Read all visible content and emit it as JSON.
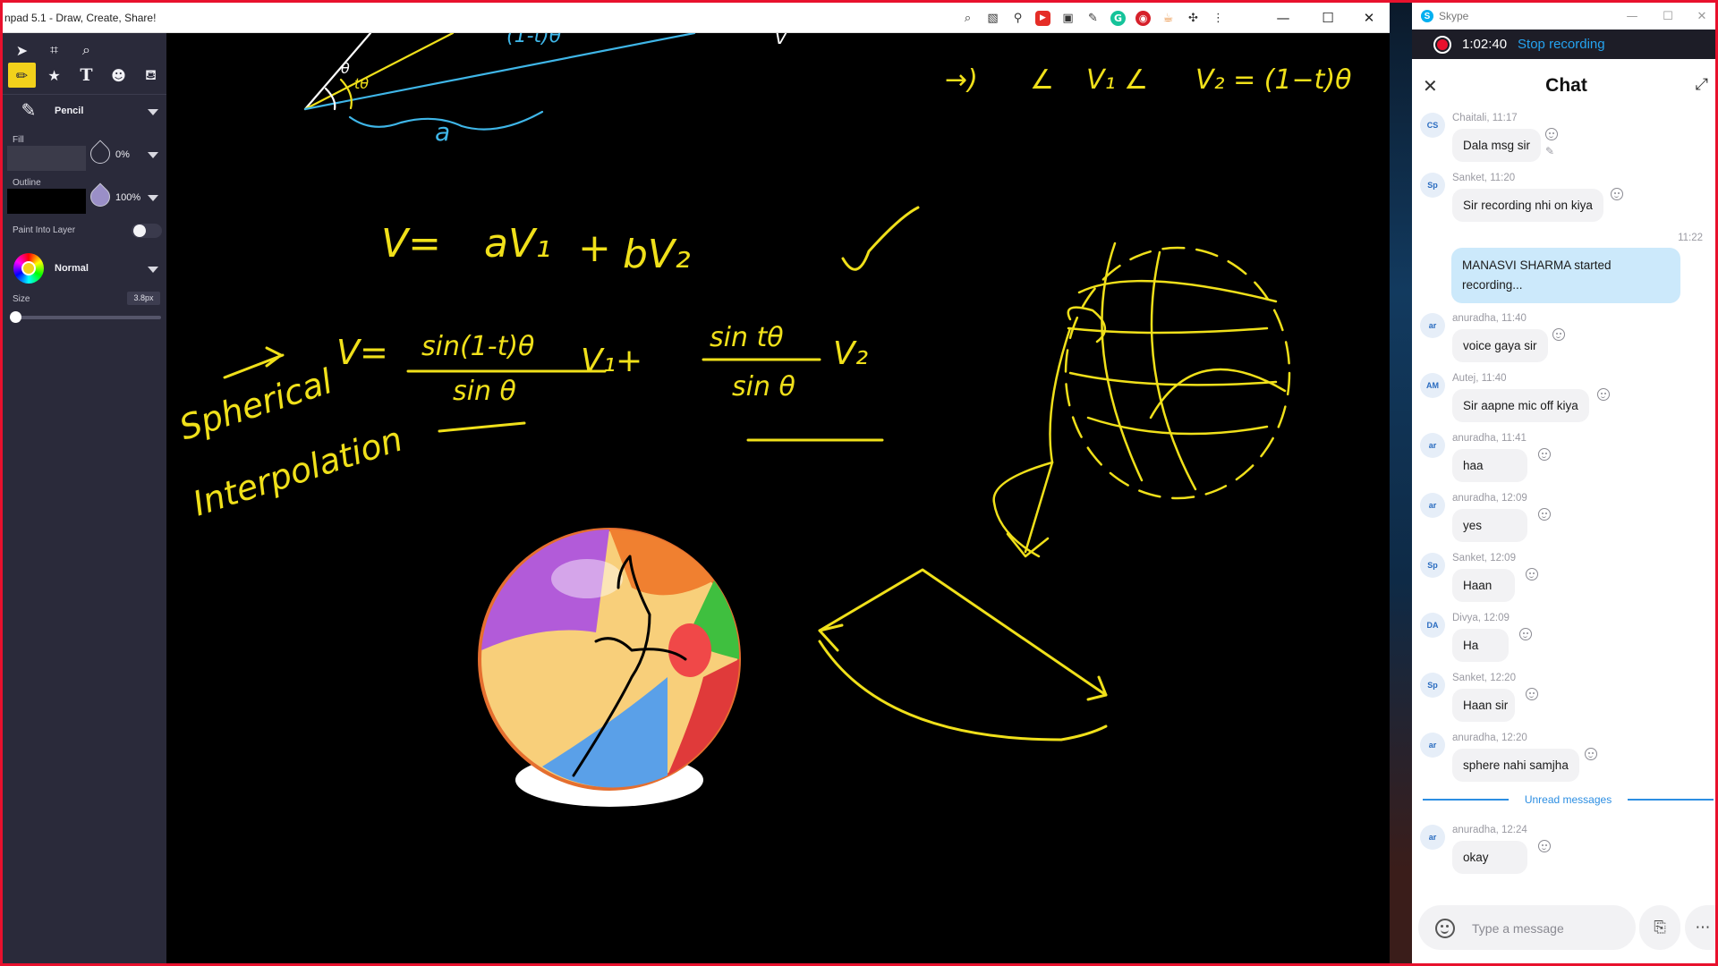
{
  "app": {
    "title": "npad 5.1 - Draw, Create, Share!",
    "window_controls": {
      "minimize": "—",
      "maximize": "☐",
      "close": "✕"
    }
  },
  "toolbar": {
    "tool_icons": [
      "pointer-icon",
      "crop-icon",
      "magnifier-icon",
      "pencil-icon",
      "star-icon",
      "text-icon",
      "sticker-icon",
      "fill-bucket-icon"
    ],
    "tool_label": "Pencil",
    "fill_label": "Fill",
    "fill_opacity": "0%",
    "outline_label": "Outline",
    "outline_opacity": "100%",
    "paint_into_layer_label": "Paint Into Layer",
    "paint_into_layer_on": false,
    "blend_mode": "Normal",
    "size_label": "Size",
    "size_value": "3.8px",
    "active_color": "#f2d11b"
  },
  "canvas": {
    "background": "#000000",
    "ink_color": "#f0e01a",
    "secondary_ink": "#3fb6e8"
  },
  "skype": {
    "window_title": "Skype",
    "window_controls": {
      "minimize": "—",
      "maximize": "☐",
      "close": "✕"
    },
    "recording_time": "1:02:40",
    "stop_recording": "Stop recording",
    "chat_title": "Chat",
    "messages": [
      {
        "avatar": "CS",
        "meta": "Chaitali, 11:17",
        "text": "Dala msg sir"
      },
      {
        "avatar": "Sp",
        "meta": "Sanket, 11:20",
        "text": "Sir recording nhi on kiya"
      },
      {
        "own_time": "11:22",
        "text": "MANASVI SHARMA started recording..."
      },
      {
        "avatar": "ar",
        "meta": "anuradha, 11:40",
        "text": "voice gaya sir"
      },
      {
        "avatar": "AM",
        "meta": "Autej, 11:40",
        "text": "Sir aapne mic off kiya"
      },
      {
        "avatar": "ar",
        "meta": "anuradha, 11:41",
        "text": "haa"
      },
      {
        "avatar": "ar",
        "meta": "anuradha, 12:09",
        "text": "yes"
      },
      {
        "avatar": "Sp",
        "meta": "Sanket, 12:09",
        "text": "Haan"
      },
      {
        "avatar": "DA",
        "meta": "Divya, 12:09",
        "text": "Ha"
      },
      {
        "avatar": "Sp",
        "meta": "Sanket, 12:20",
        "text": "Haan sir"
      },
      {
        "avatar": "ar",
        "meta": "anuradha, 12:20",
        "text": "sphere nahi samjha"
      },
      {
        "avatar": "ar",
        "meta": "anuradha, 12:24",
        "text": "okay"
      }
    ],
    "unread_label": "Unread messages",
    "composer_placeholder": "Type a message"
  }
}
